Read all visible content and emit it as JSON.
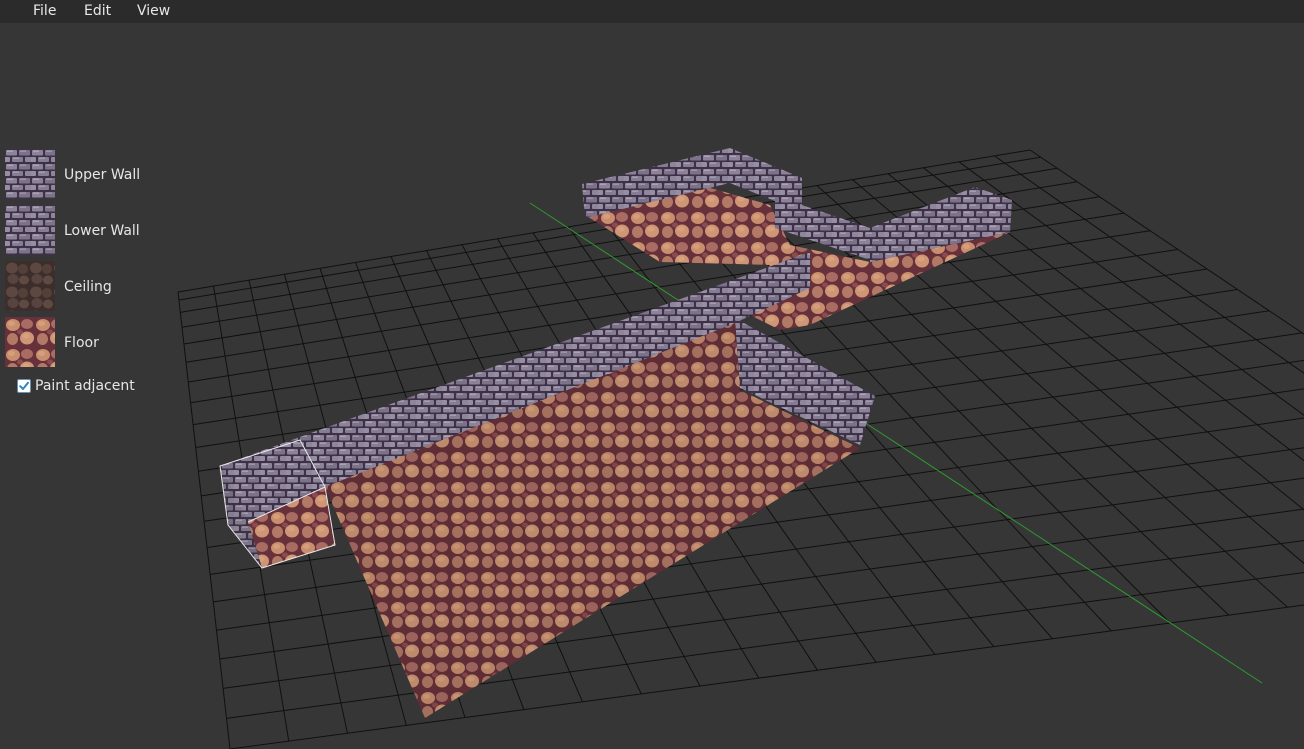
{
  "menu": {
    "file": "File",
    "edit": "Edit",
    "view": "View"
  },
  "palette": {
    "tiles": [
      {
        "label": "Upper Wall",
        "texture": "stone-brick"
      },
      {
        "label": "Lower Wall",
        "texture": "stone-brick"
      },
      {
        "label": "Ceiling",
        "texture": "dark-cobble"
      },
      {
        "label": "Floor",
        "texture": "cobble-floor"
      }
    ],
    "paint_adjacent": {
      "label": "Paint adjacent",
      "checked": true
    }
  },
  "colors": {
    "background": "#363636",
    "menubar": "#2b2b2b",
    "grid_line": "#0f0f0f",
    "axis": "#2f9a2f",
    "checkbox_accent": "#2f84c8",
    "wall_stone": "#8a8196",
    "floor_stone": "#c88c6c",
    "mortar": "#5e2e36",
    "ceiling": "#5e4a44"
  }
}
